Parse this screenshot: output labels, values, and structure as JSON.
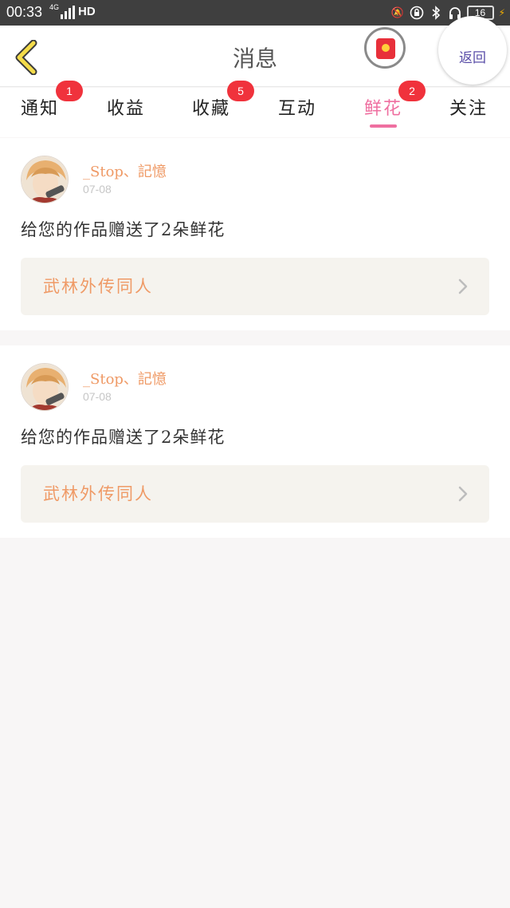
{
  "status_bar": {
    "time": "00:33",
    "network": "4G",
    "hd": "HD",
    "battery": "16",
    "icons": [
      "signal-icon",
      "mute-icon",
      "lock-rotation-icon",
      "bluetooth-icon",
      "headphones-icon",
      "battery-icon",
      "charging-icon"
    ]
  },
  "header": {
    "title": "消息",
    "return_label": "返回",
    "back_icon": "chevron-left-icon",
    "floating_icon": "red-packet-icon"
  },
  "tabs": [
    {
      "label": "通知",
      "badge": "1"
    },
    {
      "label": "收益",
      "badge": ""
    },
    {
      "label": "收藏",
      "badge": "5"
    },
    {
      "label": "互动",
      "badge": ""
    },
    {
      "label": "鲜花",
      "badge": "2"
    },
    {
      "label": "关注",
      "badge": ""
    }
  ],
  "active_tab": "鲜花",
  "colors": {
    "accent_pink": "#ef6fa0",
    "accent_orange": "#ef9a66",
    "badge_red": "#f0323c",
    "back_yellow": "#f4dc4a"
  },
  "messages": [
    {
      "username": "_Stop、記憶",
      "date": "07-08",
      "text": "给您的作品赠送了2朵鲜花",
      "work_title": "武林外传同人"
    },
    {
      "username": "_Stop、記憶",
      "date": "07-08",
      "text": "给您的作品赠送了2朵鲜花",
      "work_title": "武林外传同人"
    }
  ]
}
